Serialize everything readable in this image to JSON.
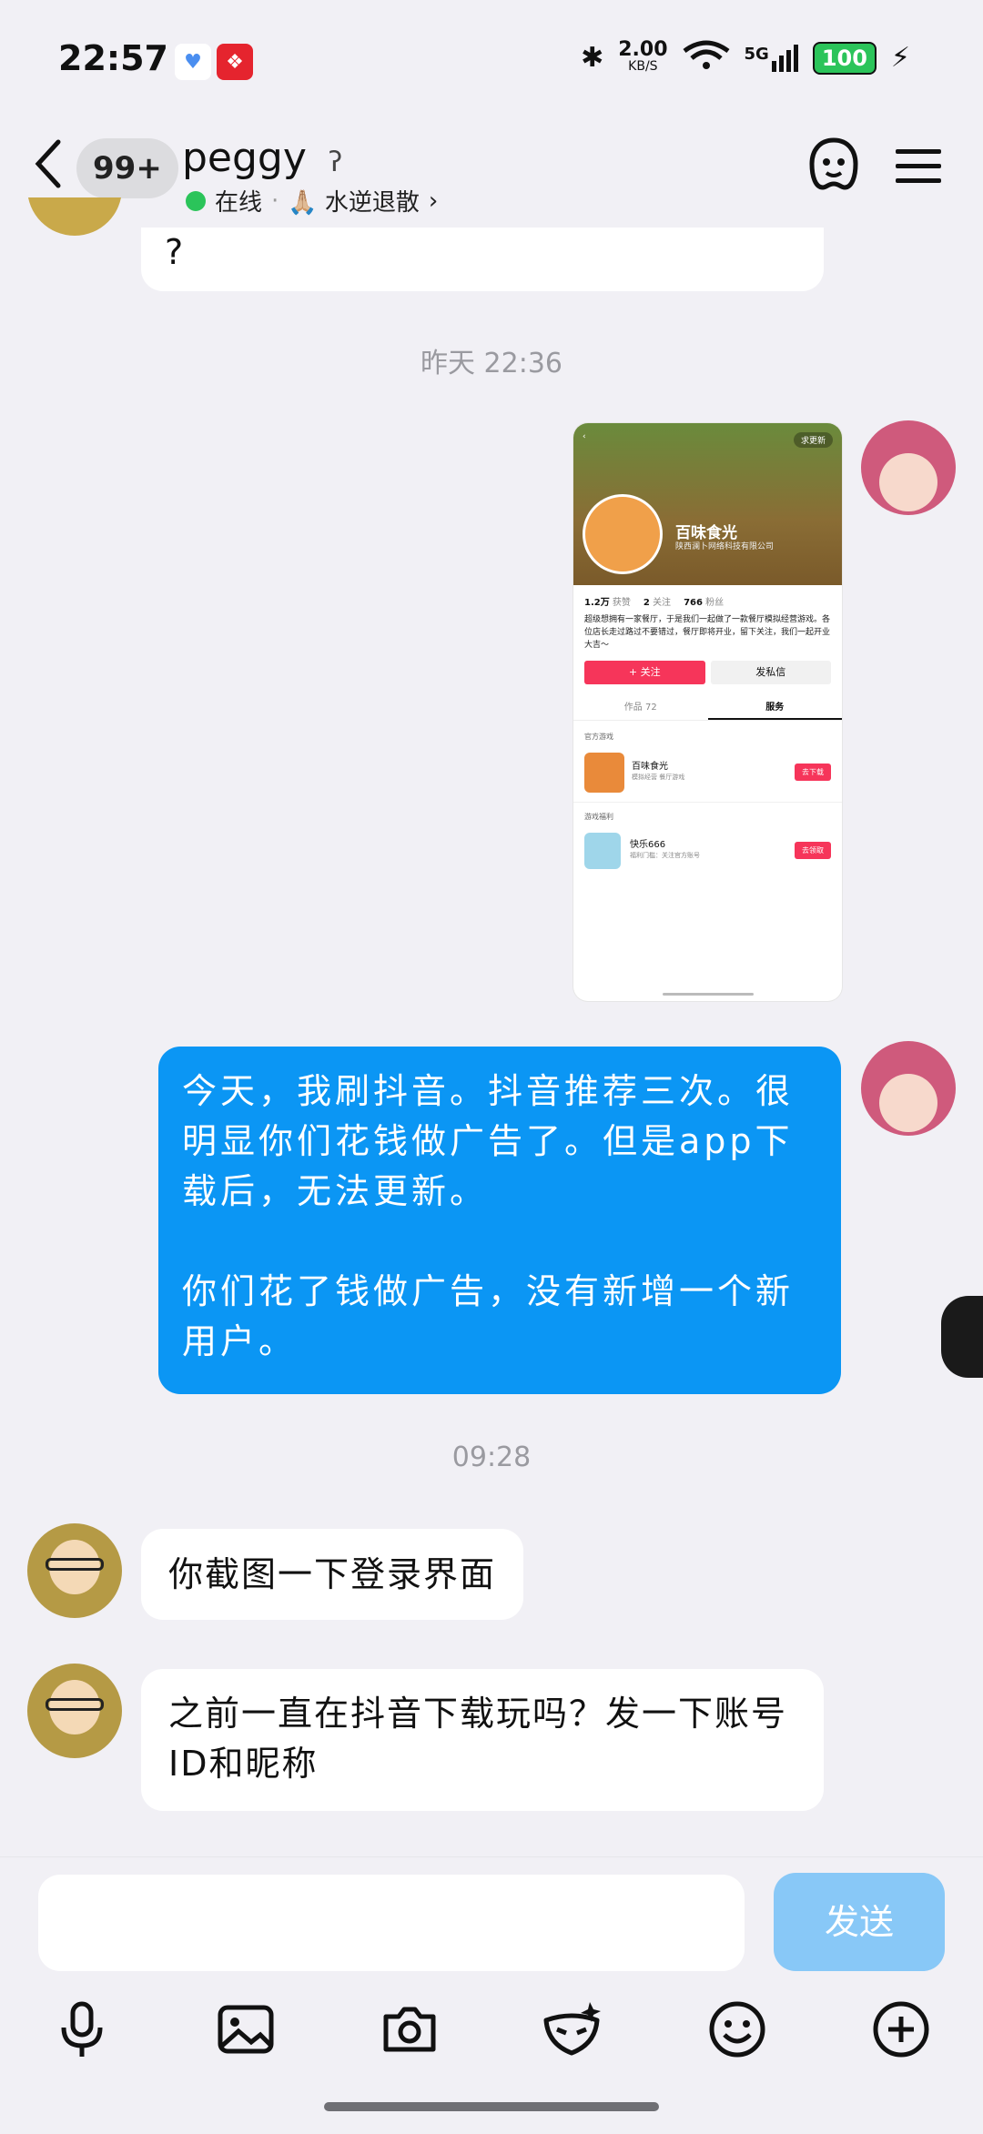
{
  "status_bar": {
    "time": "22:57",
    "speed_value": "2.00",
    "speed_unit": "KB/S",
    "network": "5G",
    "battery": "100"
  },
  "header": {
    "unread_badge": "99+",
    "contact_name": "peggy",
    "online_label": "在线",
    "signature": "🙏🏼 水逆退散",
    "sep": "·"
  },
  "messages": {
    "partial_left_text": "?",
    "ts1": "昨天 22:36",
    "screenshot": {
      "title": "百味食光",
      "company": "陕西澜卜网络科技有限公司",
      "likes": "1.2万",
      "likes_label": "获赞",
      "following": "2",
      "following_label": "关注",
      "fans": "766",
      "fans_label": "粉丝",
      "bio": "超级想拥有一家餐厅，于是我们一起做了一款餐厅模拟经营游戏。各位店长走过路过不要错过，餐厅即将开业，留下关注，我们一起开业大吉～",
      "follow": "+ 关注",
      "dm": "发私信",
      "tab_works": "作品 72",
      "tab_service": "服务",
      "section1": "官方游戏",
      "game_name": "百味食光",
      "game_tags": "模拟经营  餐厅游戏",
      "game_btn": "去下载",
      "section2": "游戏福利",
      "gift_name": "快乐666",
      "gift_desc": "福利门槛：关注官方账号",
      "gift_btn": "去领取",
      "top_btn": "求更新"
    },
    "right_msg": "今天，我刷抖音。抖音推荐三次。很明显你们花钱做广告了。但是app下载后，无法更新。\n\n你们花了钱做广告，没有新增一个新用户。",
    "ts2": "09:28",
    "left_msg1": "你截图一下登录界面",
    "left_msg2": "之前一直在抖音下载玩吗？发一下账号ID和昵称"
  },
  "composer": {
    "placeholder": "",
    "send_label": "发送"
  },
  "colors": {
    "right_bubble": "#0b96f4",
    "send_disabled": "#88c8f7",
    "online": "#2bc45a",
    "battery": "#2bc45a"
  }
}
